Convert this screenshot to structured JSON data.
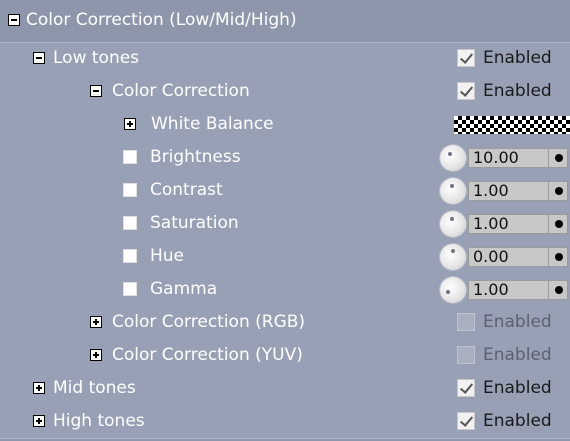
{
  "tree": {
    "root": {
      "label": "Color Correction (Low/Mid/High)"
    },
    "low_tones": {
      "label": "Low tones",
      "enabled_label": "Enabled"
    },
    "cc": {
      "label": "Color Correction",
      "enabled_label": "Enabled"
    },
    "white_balance": {
      "label": "White Balance"
    },
    "params": [
      {
        "label": "Brightness",
        "value": "10.00"
      },
      {
        "label": "Contrast",
        "value": "1.00"
      },
      {
        "label": "Saturation",
        "value": "1.00"
      },
      {
        "label": "Hue",
        "value": "0.00"
      },
      {
        "label": "Gamma",
        "value": "1.00"
      }
    ],
    "cc_rgb": {
      "label": "Color Correction (RGB)",
      "enabled_label": "Enabled"
    },
    "cc_yuv": {
      "label": "Color Correction (YUV)",
      "enabled_label": "Enabled"
    },
    "mid_tones": {
      "label": "Mid tones",
      "enabled_label": "Enabled"
    },
    "high_tones": {
      "label": "High tones",
      "enabled_label": "Enabled"
    }
  },
  "colors": {
    "background": "#8e96ab",
    "row_highlight": "#98a0b5",
    "text": "#ffffff"
  }
}
